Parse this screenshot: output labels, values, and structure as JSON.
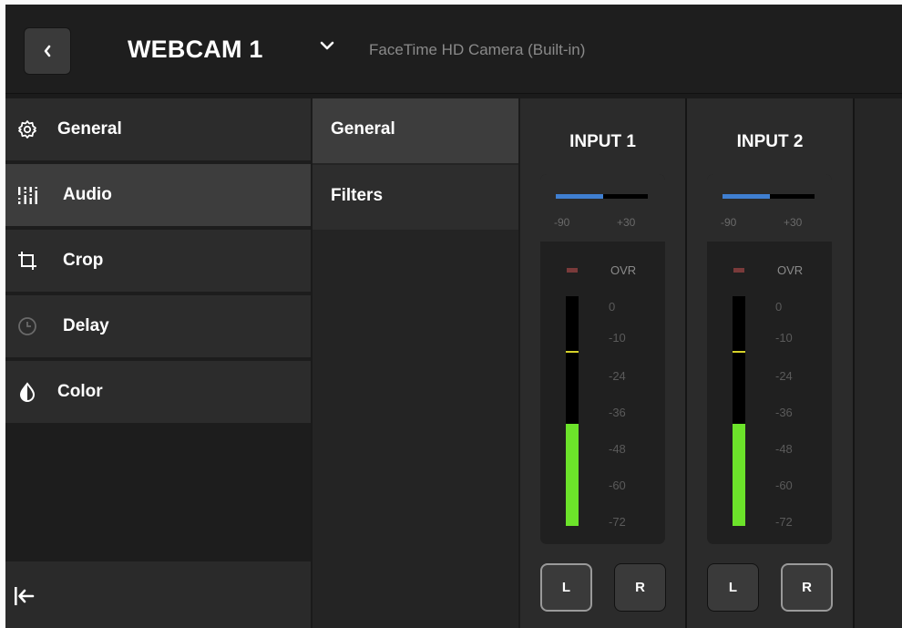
{
  "header": {
    "title": "WEBCAM 1",
    "subtitle": "FaceTime HD Camera (Built-in)"
  },
  "nav": {
    "items": [
      {
        "label": "General",
        "icon": "gear-icon"
      },
      {
        "label": "Audio",
        "icon": "audio-sliders-icon",
        "active": true
      },
      {
        "label": "Crop",
        "icon": "crop-icon"
      },
      {
        "label": "Delay",
        "icon": "clock-icon"
      },
      {
        "label": "Color",
        "icon": "color-drop-icon"
      }
    ]
  },
  "tabs": [
    {
      "label": "General",
      "active": true
    },
    {
      "label": "Filters"
    }
  ],
  "inputs": [
    {
      "title": "INPUT 1",
      "gain_min": "-90",
      "gain_max": "+30",
      "ovr": "OVR",
      "ticks": [
        "0",
        "-10",
        "-24",
        "-36",
        "-48",
        "-60",
        "-72"
      ],
      "left_label": "L",
      "right_label": "R",
      "selected_channel": "L"
    },
    {
      "title": "INPUT 2",
      "gain_min": "-90",
      "gain_max": "+30",
      "ovr": "OVR",
      "ticks": [
        "0",
        "-10",
        "-24",
        "-36",
        "-48",
        "-60",
        "-72"
      ],
      "left_label": "L",
      "right_label": "R",
      "selected_channel": "R"
    }
  ],
  "colors": {
    "gain_blue": "#3f7fd1",
    "level_green": "#6ce32a",
    "peak_yellow": "#d6d22a",
    "ovr_red": "#7a3a3a"
  }
}
